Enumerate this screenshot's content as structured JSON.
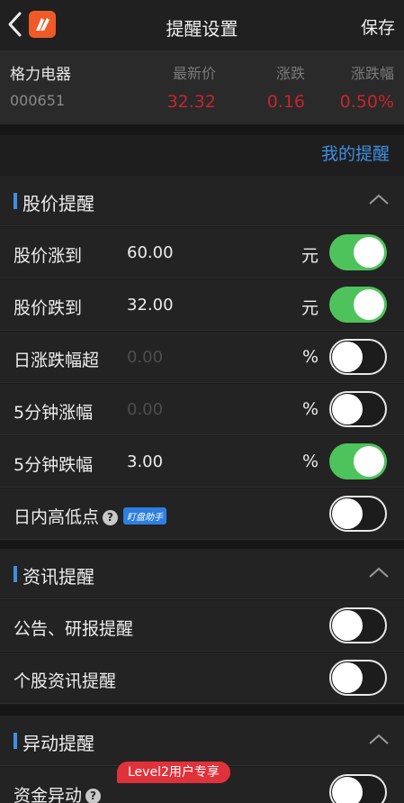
{
  "nav": {
    "title": "提醒设置",
    "save": "保存"
  },
  "stock": {
    "name": "格力电器",
    "code": "000651",
    "price_label": "最新价",
    "price": "32.32",
    "change_label": "涨跌",
    "change": "0.16",
    "pct_label": "涨跌幅",
    "pct": "0.50%"
  },
  "my_reminders": "我的提醒",
  "sections": {
    "price": {
      "title": "股价提醒",
      "rows": [
        {
          "label": "股价涨到",
          "value": "60.00",
          "unit": "元",
          "on": true
        },
        {
          "label": "股价跌到",
          "value": "32.00",
          "unit": "元",
          "on": true
        },
        {
          "label": "日涨跌幅超",
          "value": "0.00",
          "unit": "%",
          "on": false
        },
        {
          "label": "5分钟涨幅",
          "value": "0.00",
          "unit": "%",
          "on": false
        },
        {
          "label": "5分钟跌幅",
          "value": "3.00",
          "unit": "%",
          "on": true
        },
        {
          "label": "日内高低点",
          "badge": "盯盘助手",
          "on": false
        }
      ]
    },
    "news": {
      "title": "资讯提醒",
      "rows": [
        {
          "label": "公告、研报提醒",
          "on": false
        },
        {
          "label": "个股资讯提醒",
          "on": false
        }
      ]
    },
    "anomaly": {
      "title": "异动提醒",
      "rows": [
        {
          "label": "资金异动",
          "badge": "Level2用户专享",
          "on": false
        }
      ]
    }
  },
  "colors": {
    "accent": "#3f8ee0",
    "up": "#c8242d",
    "toggle_on": "#4ec35c",
    "logo": "#f05a28"
  },
  "icons": {
    "back": "chevron-left-icon",
    "help": "question-circle-icon",
    "collapse": "chevron-up-icon"
  }
}
